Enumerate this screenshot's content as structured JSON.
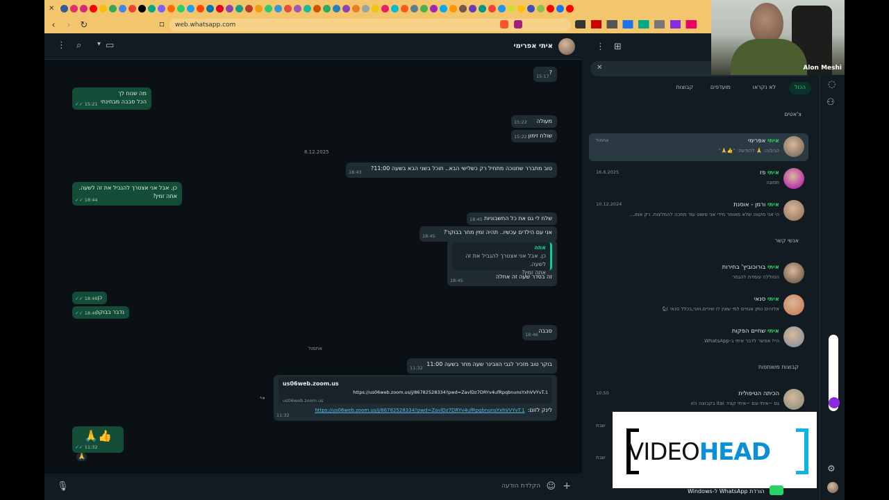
{
  "browser": {
    "url": "web.whatsapp.com",
    "favicon_colors": [
      "#3b5998",
      "#e1306c",
      "#d62976",
      "#ff0000",
      "#fbbc04",
      "#34a853",
      "#4285f4",
      "#ea4335",
      "#000000",
      "#00a884",
      "#7b61ff",
      "#ff6d00",
      "#25d366",
      "#1da1f2",
      "#ff4500",
      "#0077b5",
      "#e60023",
      "#8e44ad",
      "#16a085",
      "#c0392b",
      "#f39c12",
      "#2ecc71",
      "#3498db",
      "#e74c3c",
      "#9b59b6",
      "#1abc9c",
      "#d35400",
      "#27ae60",
      "#2980b9",
      "#8e44ad",
      "#e67e22",
      "#95a5a6",
      "#f1c40f",
      "#e91e63",
      "#00bcd4",
      "#ff5722",
      "#607d8b",
      "#4caf50",
      "#9c27b0",
      "#03a9f4",
      "#ff9800",
      "#795548",
      "#673ab7",
      "#009688",
      "#f44336",
      "#2196f3",
      "#cddc39",
      "#ffc107",
      "#3f51b5",
      "#8bc34a",
      "#ff0000",
      "#1877f2",
      "#ff0000"
    ]
  },
  "chat": {
    "contact_name": "איתי אפרימי",
    "messages": [
      {
        "dir": "in",
        "text": "?",
        "time": "15:17"
      },
      {
        "dir": "out",
        "text": "מה שנוח לך\nהכל סבבה מבחינתי",
        "time": "15:21"
      },
      {
        "dir": "in",
        "text": "מעולה",
        "time": "15:22"
      },
      {
        "dir": "in",
        "text": "שולח זימון",
        "time": "15:22"
      },
      {
        "dir": "in",
        "text": "טוב מתברר שחנוכה מתחיל רק כשלישי הבא.. תוכל בשני הבא בשעה 11:00?",
        "time": "18:43"
      },
      {
        "dir": "out",
        "text": "כן. אבל אני אצטרך להגביל את זה לשעה.\nאתה זמין?",
        "time": "18:44"
      },
      {
        "dir": "in",
        "text": "שלח לי גם את כל החשבוניות",
        "time": "18:45"
      },
      {
        "dir": "in",
        "text": "אני עם הילדים עכשיו.. תהיה זמין מחר בבוקר?",
        "time": "18:45"
      },
      {
        "dir": "in",
        "quote_author": "אתה",
        "quote_text": "כן. אבל אני אצטרך להגביל את זה לשעה.\nאתה זמין?",
        "text": "זה בסדר שעה זה אחלה",
        "time": "18:45"
      },
      {
        "dir": "out",
        "text": "כן",
        "time": "18:46"
      },
      {
        "dir": "out",
        "text": "נדבר בבוקר",
        "time": "18:46"
      },
      {
        "dir": "in",
        "text": "סבבה",
        "time": "18:46"
      },
      {
        "dir": "in",
        "text": "בוקר טוב מזכיר לגבי הוובינר שעה מחר בשעה 11:00",
        "time": "11:32"
      },
      {
        "dir": "in",
        "link_title": "us06web.zoom.us",
        "link_url": "https://us06web.zoom.us/j/86782528334?pwd=ZavlDz7DRYv4ufRpqbnunsYxhVVYvT.1",
        "link_domain": "us06web.zoom.us",
        "text_prefix": "לינק לזום:",
        "text_link": "https://us06web.zoom.us/j/86782528334?pwd=ZavlDz7DRYv4ufRpqbnunsYxhVVYvT.1",
        "time": "11:32"
      },
      {
        "dir": "out",
        "text": "👍🙏",
        "time": "11:32",
        "reaction": "🙏"
      }
    ],
    "dates": {
      "d1": "8.12.2025",
      "d2": "אתמול"
    },
    "input_placeholder": "הקלדת הודעה"
  },
  "sidebar": {
    "filters": [
      "הכול",
      "לא נקראו",
      "מועדפים",
      "קבוצות"
    ],
    "sections": {
      "chats": "צ'אטים",
      "contacts": "אנשי קשר",
      "groups": "קבוצות משותפות"
    },
    "chats": [
      {
        "hl": "איתי",
        "rest": " אפרימי",
        "preview": "הגיב/ה: 🙏 להודעה: \"👍🙏\"",
        "date": "אתמול",
        "avatar": "#6b5a4e"
      },
      {
        "hl": "איתי",
        "rest": " פז",
        "preview": "תמונה",
        "date": "16.6.2025",
        "avatar": "#b000b0"
      },
      {
        "hl": "איתי",
        "rest": " ורמן - אוסנת",
        "preview": "הי אני מקווה שלא מאוחר מידי אני פשוט עוד מחכה להמלצות. רק אמו...",
        "date": "10.12.2024",
        "avatar": "#8a6a52"
      }
    ],
    "contacts": [
      {
        "hl": "איתי",
        "rest": " בורוכוביץ' בחירות",
        "preview": "הסוללה עומדת להגמר",
        "avatar": "#5a4636"
      },
      {
        "hl": "איתי",
        "rest": " סנאי",
        "preview": "אלוהים נותן אגוזים למי שאין לו שיניים.ואני,בכלל סנאי 🐿",
        "avatar": "#c9714a"
      },
      {
        "hl": "איתי",
        "rest": " שחיים הפקות",
        "preview": "היי! אפשר לדבר איתי ב-WhatsApp.",
        "avatar": "#7a8a9a"
      }
    ],
    "groups": [
      {
        "name": "הכיתה הטיפולית",
        "preview": "גם ~איתי וגם ~איתי קציר itai בקבוצה הזו",
        "date": "10:50",
        "avatar": "#7d8a7a"
      }
    ],
    "extra_dates": [
      "שבת",
      "שבת"
    ],
    "footer": "הורדת WhatsApp ל-Windows"
  },
  "webcam": {
    "label": "Alon Meshi"
  },
  "watermark": {
    "prefix": "VIDEO",
    "suffix": "HEAD"
  }
}
